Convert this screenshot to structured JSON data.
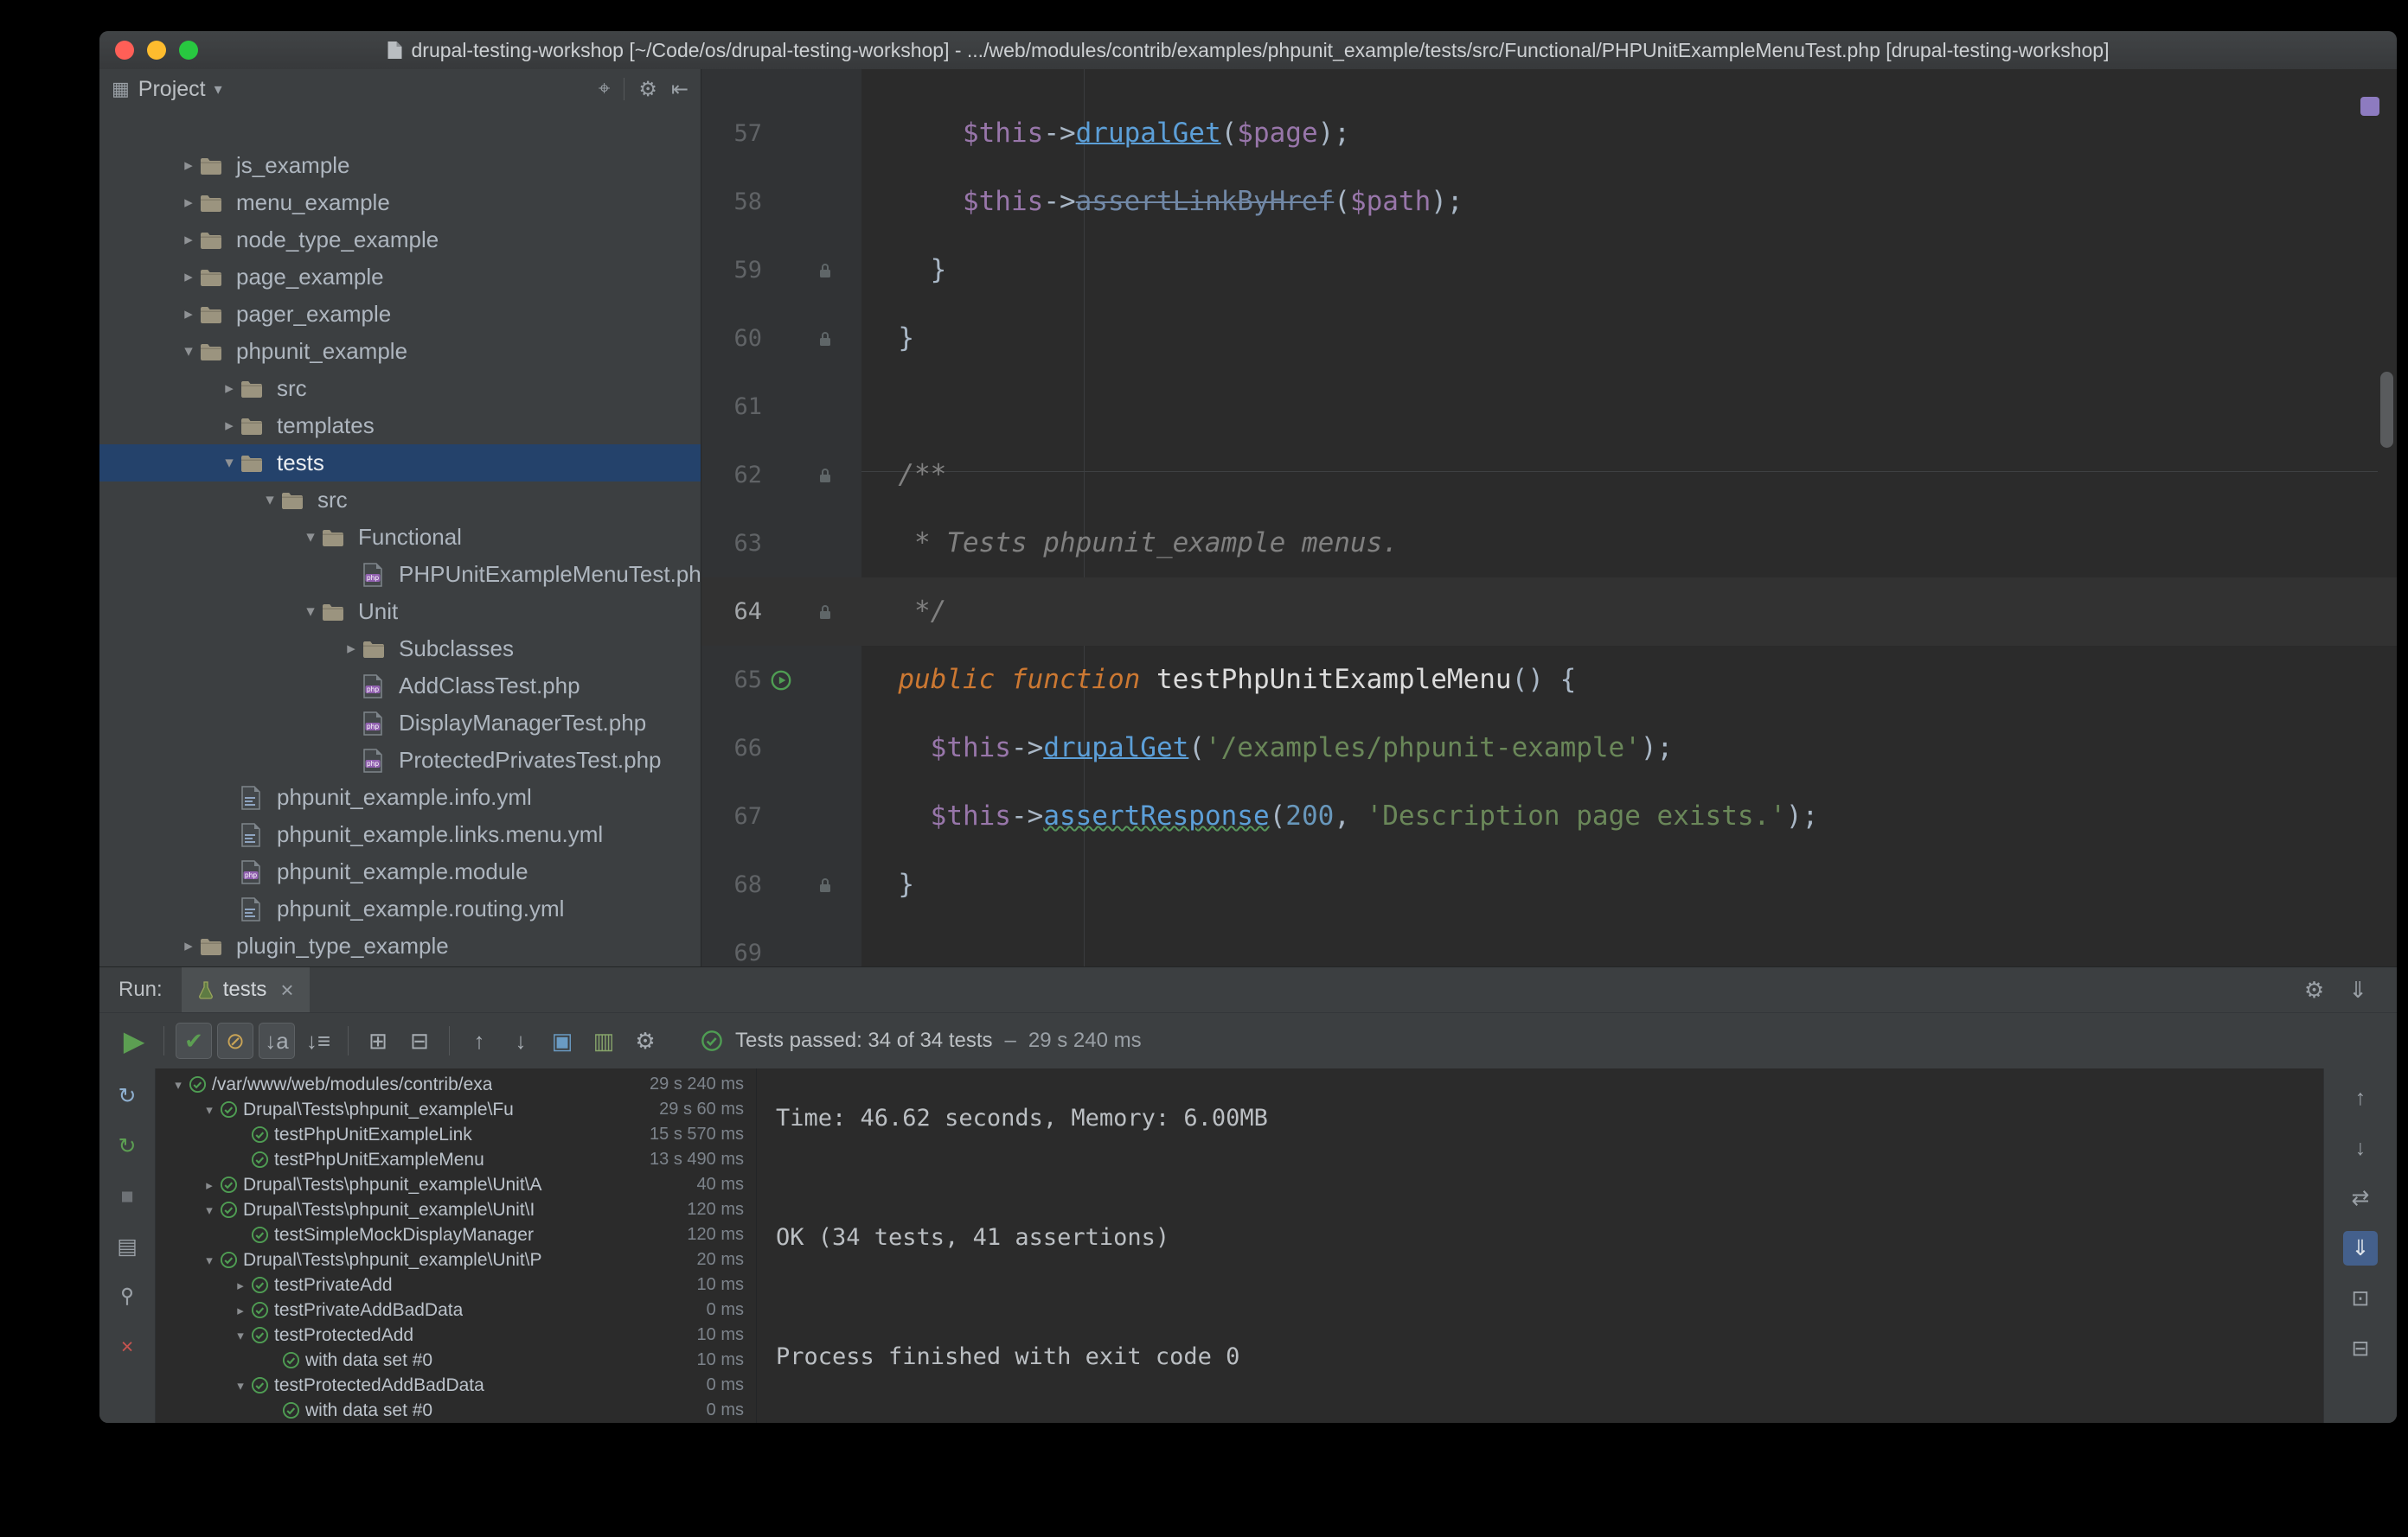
{
  "window": {
    "title": "drupal-testing-workshop [~/Code/os/drupal-testing-workshop] - .../web/modules/contrib/examples/phpunit_example/tests/src/Functional/PHPUnitExampleMenuTest.php [drupal-testing-workshop]"
  },
  "colors": {
    "pass_green": "#4f9d53",
    "error_red": "#c75450",
    "selection_blue": "#24426b",
    "panel_bg": "#3c3f41",
    "editor_bg": "#2b2b2b"
  },
  "project_panel": {
    "header": {
      "window_icon": "▦",
      "title": "Project",
      "caret": "▾",
      "icons": [
        {
          "name": "locate-file-icon",
          "glyph": "⌖"
        },
        {
          "name": "divider"
        },
        {
          "name": "settings-gear-icon",
          "glyph": "⚙"
        },
        {
          "name": "hide-panel-icon",
          "glyph": "⇤"
        }
      ]
    },
    "tree": [
      {
        "label": "js_example",
        "level": 0,
        "kind": "folder",
        "state": "collapsed"
      },
      {
        "label": "menu_example",
        "level": 0,
        "kind": "folder",
        "state": "collapsed"
      },
      {
        "label": "node_type_example",
        "level": 0,
        "kind": "folder",
        "state": "collapsed"
      },
      {
        "label": "page_example",
        "level": 0,
        "kind": "folder",
        "state": "collapsed"
      },
      {
        "label": "pager_example",
        "level": 0,
        "kind": "folder",
        "state": "collapsed"
      },
      {
        "label": "phpunit_example",
        "level": 0,
        "kind": "folder",
        "state": "expanded"
      },
      {
        "label": "src",
        "level": 1,
        "kind": "folder",
        "state": "collapsed"
      },
      {
        "label": "templates",
        "level": 1,
        "kind": "folder",
        "state": "collapsed"
      },
      {
        "label": "tests",
        "level": 1,
        "kind": "folder",
        "state": "expanded",
        "selected": true
      },
      {
        "label": "src",
        "level": 2,
        "kind": "folder",
        "state": "expanded"
      },
      {
        "label": "Functional",
        "level": 3,
        "kind": "folder",
        "state": "expanded"
      },
      {
        "label": "PHPUnitExampleMenuTest.php",
        "level": 4,
        "kind": "php",
        "state": "leaf"
      },
      {
        "label": "Unit",
        "level": 3,
        "kind": "folder",
        "state": "expanded"
      },
      {
        "label": "Subclasses",
        "level": 4,
        "kind": "folder",
        "state": "collapsed"
      },
      {
        "label": "AddClassTest.php",
        "level": 4,
        "kind": "php",
        "state": "leaf"
      },
      {
        "label": "DisplayManagerTest.php",
        "level": 4,
        "kind": "php",
        "state": "leaf"
      },
      {
        "label": "ProtectedPrivatesTest.php",
        "level": 4,
        "kind": "php",
        "state": "leaf"
      },
      {
        "label": "phpunit_example.info.yml",
        "level": 1,
        "kind": "yml",
        "state": "leaf"
      },
      {
        "label": "phpunit_example.links.menu.yml",
        "level": 1,
        "kind": "yml",
        "state": "leaf"
      },
      {
        "label": "phpunit_example.module",
        "level": 1,
        "kind": "php",
        "state": "leaf"
      },
      {
        "label": "phpunit_example.routing.yml",
        "level": 1,
        "kind": "yml",
        "state": "leaf"
      },
      {
        "label": "plugin_type_example",
        "level": 0,
        "kind": "folder",
        "state": "collapsed"
      }
    ]
  },
  "editor": {
    "lines": [
      {
        "num": "57",
        "icon": null,
        "current": false,
        "tokens": [
          [
            "      ",
            "pln"
          ],
          [
            "$this",
            "var"
          ],
          [
            "->",
            "pln"
          ],
          [
            "drupalGet",
            "lnk"
          ],
          [
            "(",
            "pln"
          ],
          [
            "$page",
            "var"
          ],
          [
            ");",
            "pln"
          ]
        ]
      },
      {
        "num": "58",
        "icon": null,
        "current": false,
        "tokens": [
          [
            "      ",
            "pln"
          ],
          [
            "$this",
            "var"
          ],
          [
            "->",
            "pln"
          ],
          [
            "assertLinkByHref",
            "dep"
          ],
          [
            "(",
            "pln"
          ],
          [
            "$path",
            "var"
          ],
          [
            ");",
            "pln"
          ]
        ]
      },
      {
        "num": "59",
        "icon": "lock",
        "current": false,
        "tokens": [
          [
            "    }",
            "pln"
          ]
        ]
      },
      {
        "num": "60",
        "icon": "lock",
        "current": false,
        "tokens": [
          [
            "  }",
            "pln"
          ]
        ]
      },
      {
        "num": "61",
        "icon": null,
        "current": false,
        "tokens": []
      },
      {
        "num": "62",
        "icon": "lock",
        "current": false,
        "tokens": [
          [
            "  /**",
            "cmt"
          ]
        ]
      },
      {
        "num": "63",
        "icon": null,
        "current": false,
        "tokens": [
          [
            "   * Tests phpunit_example menus.",
            "cmt"
          ]
        ]
      },
      {
        "num": "64",
        "icon": "lock",
        "current": true,
        "tokens": [
          [
            "   */",
            "cmt"
          ]
        ]
      },
      {
        "num": "65",
        "icon": "run",
        "current": false,
        "tokens": [
          [
            "  ",
            "pln"
          ],
          [
            "public function",
            "kw"
          ],
          [
            " ",
            "pln"
          ],
          [
            "testPhpUnitExampleMenu",
            "dcl"
          ],
          [
            "() {",
            "pln"
          ]
        ]
      },
      {
        "num": "66",
        "icon": null,
        "current": false,
        "tokens": [
          [
            "    ",
            "pln"
          ],
          [
            "$this",
            "var"
          ],
          [
            "->",
            "pln"
          ],
          [
            "drupalGet",
            "lnk"
          ],
          [
            "(",
            "pln"
          ],
          [
            "'/examples/phpunit-example'",
            "str"
          ],
          [
            ");",
            "pln"
          ]
        ]
      },
      {
        "num": "67",
        "icon": null,
        "current": false,
        "tokens": [
          [
            "    ",
            "pln"
          ],
          [
            "$this",
            "var"
          ],
          [
            "->",
            "pln"
          ],
          [
            "assertResponse",
            "wav"
          ],
          [
            "(",
            "pln"
          ],
          [
            "200",
            "num"
          ],
          [
            ", ",
            "pln"
          ],
          [
            "'Description page exists.'",
            "str"
          ],
          [
            ");",
            "pln"
          ]
        ]
      },
      {
        "num": "68",
        "icon": "lock",
        "current": false,
        "tokens": [
          [
            "  }",
            "pln"
          ]
        ]
      },
      {
        "num": "69",
        "icon": null,
        "current": false,
        "tokens": []
      }
    ]
  },
  "run_panel": {
    "label": "Run:",
    "tab": {
      "title": "tests",
      "close": "×"
    },
    "tabrow_icons": [
      {
        "name": "settings-gear-icon",
        "glyph": "⚙"
      },
      {
        "name": "dock-pinned-icon",
        "glyph": "⇓"
      }
    ],
    "toolbar": [
      {
        "name": "run-button",
        "glyph": "▶",
        "color": "#5c9e52",
        "big": true
      },
      {
        "sep": true
      },
      {
        "name": "show-passed-icon",
        "glyph": "✔",
        "color": "#5c9e52",
        "pressed": true
      },
      {
        "name": "show-ignored-icon",
        "glyph": "⊘",
        "color": "#c8a356",
        "pressed": true
      },
      {
        "name": "sort-alphabetically-icon",
        "glyph": "↓a",
        "color": "#a7adb3",
        "pressed": true
      },
      {
        "name": "sort-by-duration-icon",
        "glyph": "↓≡",
        "color": "#a7adb3"
      },
      {
        "sep": true
      },
      {
        "name": "expand-all-icon",
        "glyph": "⊞",
        "color": "#a7adb3"
      },
      {
        "name": "collapse-all-icon",
        "glyph": "⊟",
        "color": "#a7adb3"
      },
      {
        "sep": true
      },
      {
        "name": "previous-occurrence-icon",
        "glyph": "↑",
        "color": "#a7adb3"
      },
      {
        "name": "next-occurrence-icon",
        "glyph": "↓",
        "color": "#a7adb3"
      },
      {
        "name": "export-test-results-icon",
        "glyph": "▣",
        "color": "#6a9bc3"
      },
      {
        "name": "import-test-results-icon",
        "glyph": "▥",
        "color": "#86a36a"
      },
      {
        "name": "test-settings-gear-icon",
        "glyph": "⚙",
        "color": "#a7adb3"
      }
    ],
    "status": {
      "text": "Tests passed: 34 of 34 tests",
      "separator": "–",
      "time": "29 s 240 ms"
    },
    "left_toolbar": [
      {
        "name": "rerun-icon",
        "glyph": "↻",
        "color": "#8fb0d0"
      },
      {
        "name": "rerun-failed-icon",
        "glyph": "↻",
        "color": "#5c9e52"
      },
      {
        "name": "stop-icon",
        "glyph": "■",
        "color": "#6e7276"
      },
      {
        "name": "console-icon",
        "glyph": "▤",
        "color": "#9aa0a6"
      },
      {
        "name": "pin-icon",
        "glyph": "pin-svg",
        "color": "#9aa0a6"
      },
      {
        "name": "close-icon",
        "glyph": "×",
        "color": "#c75450"
      }
    ],
    "right_toolbar": [
      {
        "name": "scroll-up-icon",
        "glyph": "↑"
      },
      {
        "name": "scroll-down-icon",
        "glyph": "↓"
      },
      {
        "name": "soft-wrap-icon",
        "glyph": "⇄"
      },
      {
        "name": "scroll-to-end-icon",
        "glyph": "⇓",
        "selected": true
      },
      {
        "name": "print-icon",
        "glyph": "⊡"
      },
      {
        "name": "clear-all-icon",
        "glyph": "⊟"
      }
    ],
    "tests": [
      {
        "label": "/var/www/web/modules/contrib/exa",
        "duration": "29 s 240 ms",
        "level": 0,
        "state": "expanded"
      },
      {
        "label": "Drupal\\Tests\\phpunit_example\\Fu",
        "duration": "29 s 60 ms",
        "level": 1,
        "state": "expanded"
      },
      {
        "label": "testPhpUnitExampleLink",
        "duration": "15 s 570 ms",
        "level": 2,
        "state": "leaf"
      },
      {
        "label": "testPhpUnitExampleMenu",
        "duration": "13 s 490 ms",
        "level": 2,
        "state": "leaf"
      },
      {
        "label": "Drupal\\Tests\\phpunit_example\\Unit\\A",
        "duration": "40 ms",
        "level": 1,
        "state": "collapsed"
      },
      {
        "label": "Drupal\\Tests\\phpunit_example\\Unit\\I",
        "duration": "120 ms",
        "level": 1,
        "state": "expanded"
      },
      {
        "label": "testSimpleMockDisplayManager",
        "duration": "120 ms",
        "level": 2,
        "state": "leaf"
      },
      {
        "label": "Drupal\\Tests\\phpunit_example\\Unit\\P",
        "duration": "20 ms",
        "level": 1,
        "state": "expanded"
      },
      {
        "label": "testPrivateAdd",
        "duration": "10 ms",
        "level": 2,
        "state": "collapsed"
      },
      {
        "label": "testPrivateAddBadData",
        "duration": "0 ms",
        "level": 2,
        "state": "collapsed"
      },
      {
        "label": "testProtectedAdd",
        "duration": "10 ms",
        "level": 2,
        "state": "expanded"
      },
      {
        "label": "with data set #0",
        "duration": "10 ms",
        "level": 3,
        "state": "leaf"
      },
      {
        "label": "testProtectedAddBadData",
        "duration": "0 ms",
        "level": 2,
        "state": "expanded"
      },
      {
        "label": "with data set #0",
        "duration": "0 ms",
        "level": 3,
        "state": "leaf"
      }
    ],
    "console": [
      "Time: 46.62 seconds, Memory: 6.00MB",
      "",
      "",
      "OK (34 tests, 41 assertions)",
      "",
      "",
      "Process finished with exit code 0"
    ]
  }
}
